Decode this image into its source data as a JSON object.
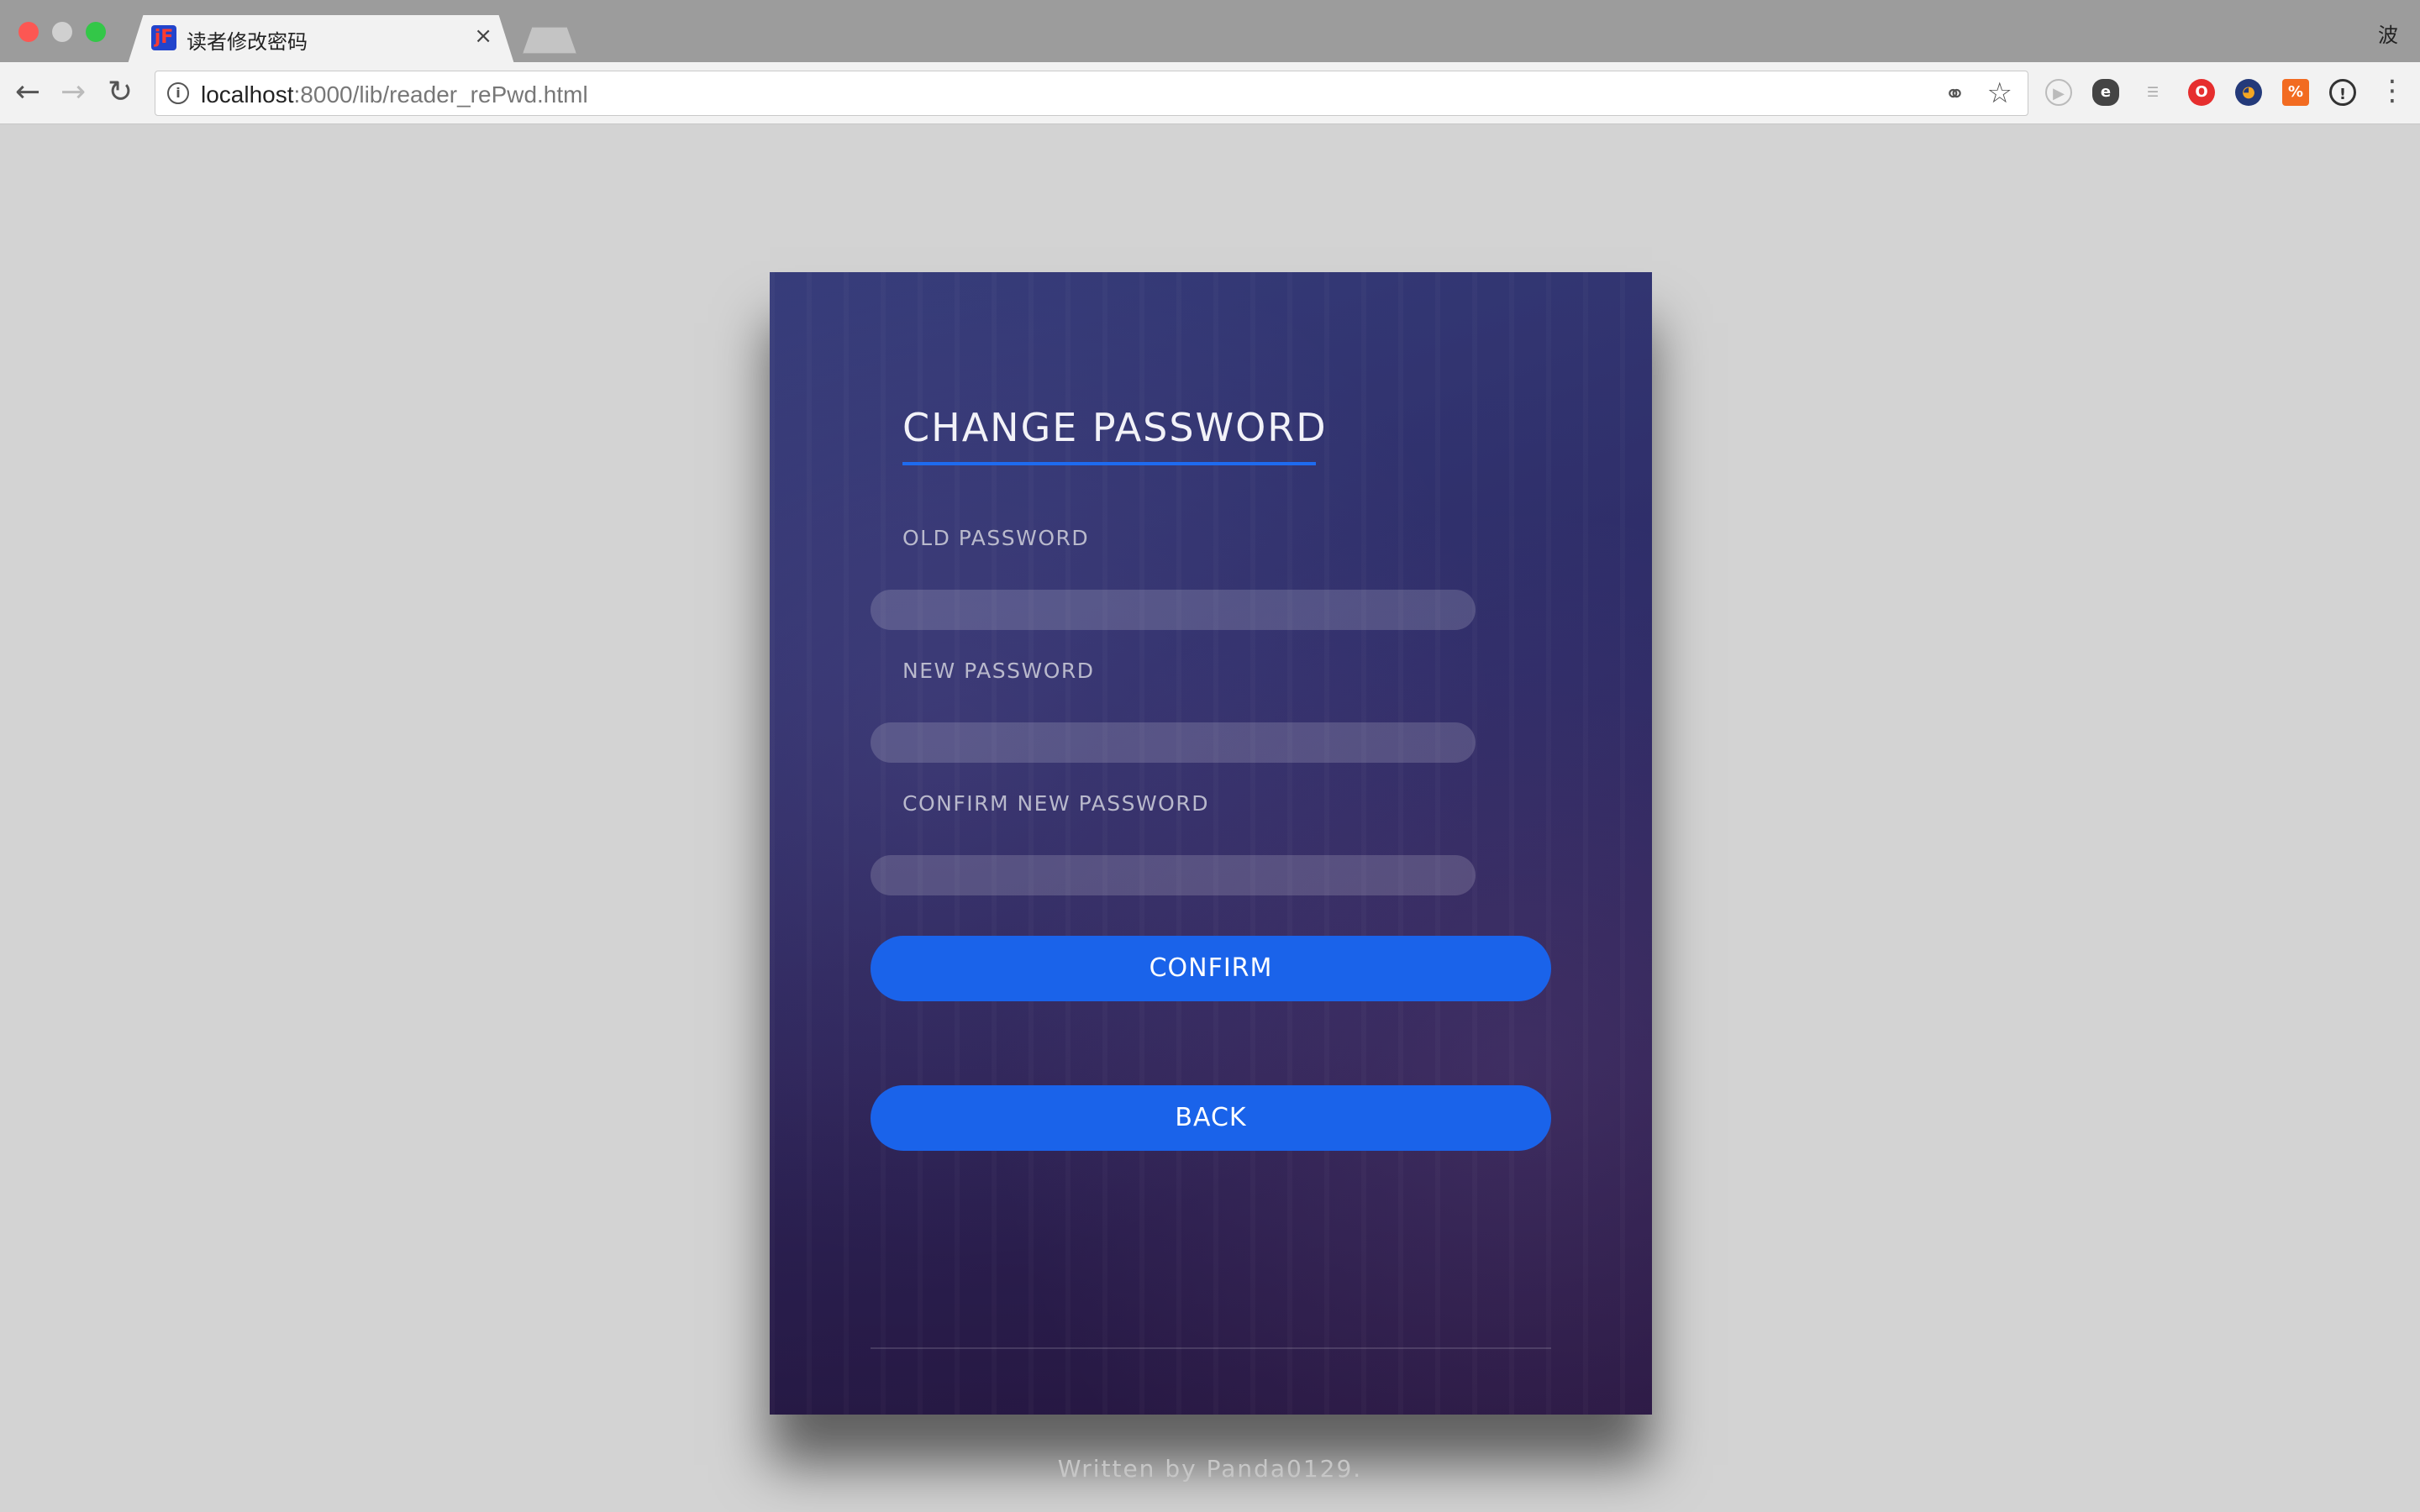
{
  "browser": {
    "tab_title": "读者修改密码",
    "tab_favicon": "jF",
    "tab_close": "×",
    "profile": "波",
    "url_host": "localhost",
    "url_path": ":8000/lib/reader_rePwd.html",
    "icons": {
      "back": "arrow-left-icon",
      "forward": "arrow-right-icon",
      "reload": "reload-icon",
      "info": "info-icon",
      "key": "key-icon",
      "star": "star-icon",
      "menu": "kebab-menu-icon"
    },
    "extensions": [
      "play-ext-icon",
      "evernote-ext-icon",
      "rss-ext-icon",
      "opera-ext-icon",
      "ext-icon",
      "percent-ext-icon",
      "onepassword-ext-icon"
    ]
  },
  "form": {
    "title": "CHANGE PASSWORD",
    "old_password_label": "OLD PASSWORD",
    "new_password_label": "NEW PASSWORD",
    "confirm_password_label": "CONFIRM NEW PASSWORD",
    "confirm_button": "CONFIRM",
    "back_button": "BACK"
  },
  "footer": "Written by Panda0129.",
  "colors": {
    "accent": "#1a63ea",
    "page_background": "#d3d3d3"
  }
}
